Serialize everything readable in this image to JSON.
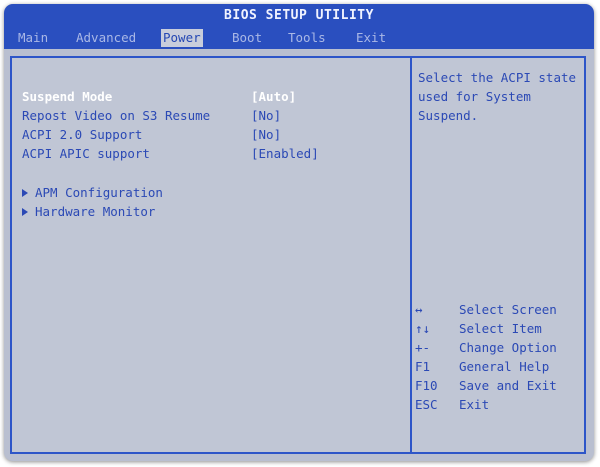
{
  "title": "BIOS SETUP UTILITY",
  "menu": [
    {
      "label": "Main"
    },
    {
      "label": "Advanced"
    },
    {
      "label": "Power",
      "active": true
    },
    {
      "label": "Boot"
    },
    {
      "label": "Tools"
    },
    {
      "label": "Exit"
    }
  ],
  "settings": [
    {
      "label": "Suspend Mode",
      "value": "[Auto]",
      "selected": true
    },
    {
      "label": "Repost Video on S3 Resume",
      "value": "[No]"
    },
    {
      "label": "ACPI 2.0 Support",
      "value": "[No]"
    },
    {
      "label": "ACPI APIC support",
      "value": "[Enabled]"
    }
  ],
  "submenus": [
    {
      "label": "APM Configuration"
    },
    {
      "label": "Hardware Monitor"
    }
  ],
  "help_text": "Select the ACPI state used for System Suspend.",
  "keys": [
    {
      "key": "↔",
      "action": "Select Screen",
      "icon": "left-right-arrow-icon"
    },
    {
      "key": "↑↓",
      "action": "Select Item",
      "icon": "up-down-arrow-icon"
    },
    {
      "key": "+-",
      "action": "Change Option"
    },
    {
      "key": "F1",
      "action": "General Help"
    },
    {
      "key": "F10",
      "action": "Save and Exit"
    },
    {
      "key": "ESC",
      "action": "Exit"
    }
  ],
  "colors": {
    "header_blue": "#2a4fbf",
    "panel_gray": "#c0c6d5",
    "text_blue": "#2b49b5",
    "selected_text": "#ffffff"
  }
}
